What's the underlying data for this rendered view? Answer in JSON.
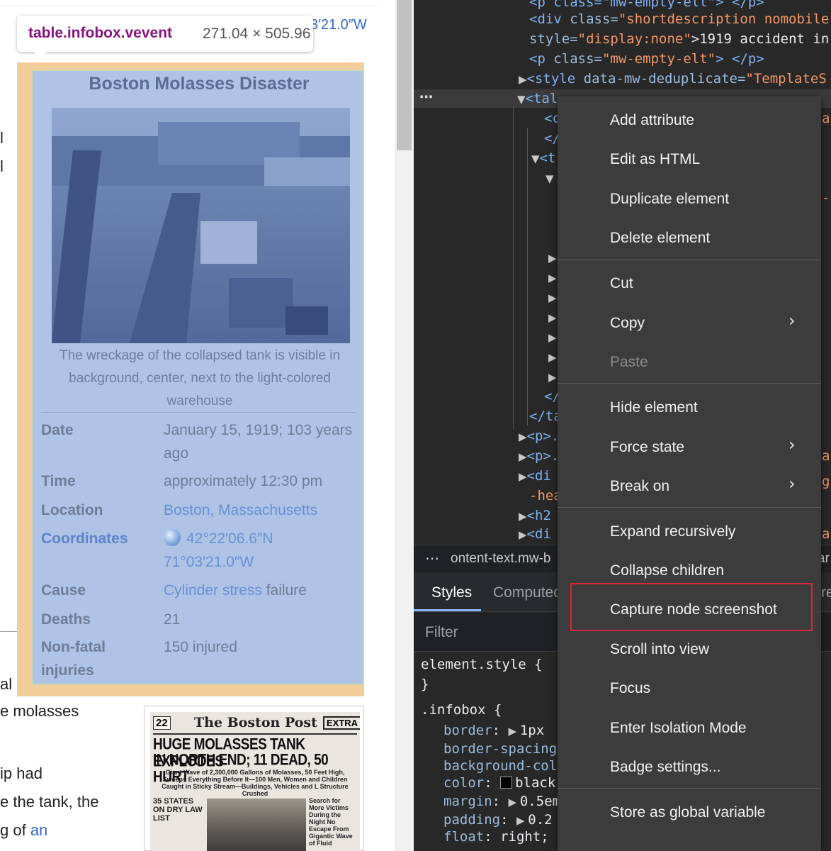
{
  "page": {
    "bg_coord": "3′21.0″W",
    "edge_texts": [
      "l",
      "l",
      "al"
    ],
    "body_lines": [
      {
        "text": "e molasses"
      },
      {
        "text": "ip had"
      },
      {
        "text": "e the tank, the"
      },
      {
        "pre": "g of ",
        "link": "an"
      }
    ]
  },
  "tooltip": {
    "tag": "table.infobox.vevent",
    "size": "271.04 × 505.96"
  },
  "infobox": {
    "title": "Boston Molasses Disaster",
    "caption": "The wreckage of the collapsed tank is visible in background, center, next to the light-colored warehouse",
    "rows": [
      {
        "label": "Date",
        "value": "January 15, 1919; 103 years ago"
      },
      {
        "label": "Time",
        "value": "approximately 12:30 pm"
      },
      {
        "label": "Location",
        "value": "Boston, Massachusetts"
      },
      {
        "label": "Coordinates",
        "value": "42°22′06.6″N 71°03′21.0″W"
      },
      {
        "label": "Cause",
        "value_link": "Cylinder stress",
        "value_rest": " failure"
      },
      {
        "label": "Deaths",
        "value": "21"
      },
      {
        "label": "Non-fatal injuries",
        "value": "150 injured"
      }
    ]
  },
  "newspaper": {
    "pages": "22",
    "name": "The Boston Post",
    "extra": "EXTRA",
    "headline1": "HUGE MOLASSES TANK EXPLODES",
    "headline2": "IN NORTH END; 11 DEAD, 50 HURT",
    "subhead": "Giant Wave of 2,300,000 Gallons of Molasses, 50 Feet High, Sweeps Everything Before It—100 Men, Women and Children Caught in Sticky Stream—Buildings, Vehicles and L Structure Crushed",
    "col_left": "35 STATES ON DRY LAW LIST",
    "col_right": "Search for More Victims During the Night No Escape From Gigantic Wave of Fluid"
  },
  "elements": {
    "line0": "<p class=\"mw-empty-elt\"> </p>",
    "line1_tag": "<div",
    "line1_attr": " class=",
    "line1_val": "\"shortdescription nomobile",
    "line2_attr": "style=",
    "line2_val": "\"display:none\"",
    "line2_text": ">1919 accident in",
    "line3_tag": "<p",
    "line3_attr": " class=",
    "line3_val": "\"mw-empty-elt\"",
    "line3_end": "> </p>",
    "line4_tag": "<style",
    "line4_attr": " data-mw-deduplicate=",
    "line4_val": "\"TemplateS",
    "line5_tag": "<tal",
    "f_c": "<c",
    "f_close": "</",
    "f_t": "<t",
    "f_ta": "</ta",
    "f_p1": "<p>.",
    "f_p2": "<p>.",
    "f_div": "<di",
    "f_hea": "-hea",
    "f_h2": "<h2",
    "f_di2": "<di",
    "r_ar1": "ar",
    "r_i": "-i",
    "r_ar2": "ar",
    "r_g": "g",
    "r_ar3": "ar"
  },
  "crumbs": {
    "text": "ontent-text.mw-b",
    "tail": "ar"
  },
  "tabs": {
    "styles": "Styles",
    "computed": "Computed",
    "right_edge": "re"
  },
  "filter": {
    "placeholder": "Filter"
  },
  "styles": {
    "element_style": "element.style {",
    "close_brace": "}",
    "infobox_rule": ".infobox {",
    "props": [
      {
        "name": "border",
        "value": "1px"
      },
      {
        "name": "border-spacing",
        "value": ""
      },
      {
        "name": "background-col",
        "value": ""
      },
      {
        "name": "color",
        "value": "black"
      },
      {
        "name": "margin",
        "value": "0.5em"
      },
      {
        "name": "padding",
        "value": "0.2"
      },
      {
        "name": "float",
        "value": "right;"
      }
    ]
  },
  "context_menu": {
    "items": [
      {
        "label": "Add attribute"
      },
      {
        "label": "Edit as HTML"
      },
      {
        "label": "Duplicate element"
      },
      {
        "label": "Delete element"
      },
      {
        "label": "Cut"
      },
      {
        "label": "Copy"
      },
      {
        "label": "Paste"
      },
      {
        "label": "Hide element"
      },
      {
        "label": "Force state"
      },
      {
        "label": "Break on"
      },
      {
        "label": "Expand recursively"
      },
      {
        "label": "Collapse children"
      },
      {
        "label": "Capture node screenshot"
      },
      {
        "label": "Scroll into view"
      },
      {
        "label": "Focus"
      },
      {
        "label": "Enter Isolation Mode"
      },
      {
        "label": "Badge settings..."
      },
      {
        "label": "Store as global variable"
      }
    ]
  },
  "colors": {
    "highlight_box": "#d7263d",
    "infobox_overlay": "#aec3e6",
    "margin_overlay": "#f3cc9c",
    "devtools_bg": "#282828"
  }
}
